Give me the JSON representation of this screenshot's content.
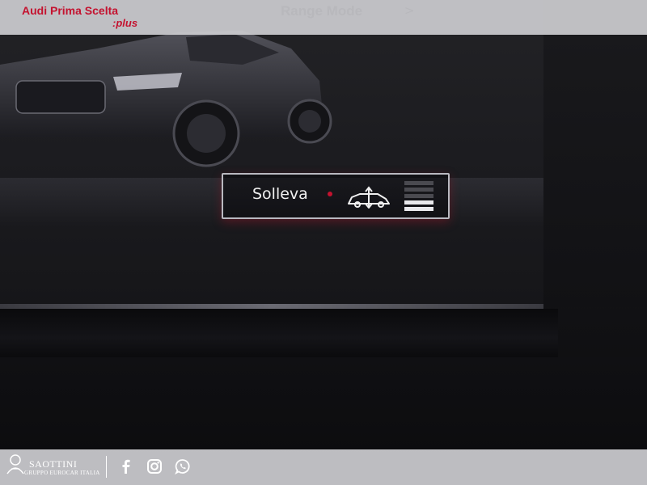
{
  "header": {
    "brand_name": "Audi Prima Scelta",
    "brand_suffix": ":plus",
    "mode_label": "Range Mode",
    "mode_arrow": ">"
  },
  "popup": {
    "label": "Solleva",
    "icon": "car-lift-icon",
    "level": 2,
    "level_count": 5
  },
  "footer": {
    "dealer_name": "SAOTTINI",
    "dealer_group": "GRUPPO EUROCAR ITALIA",
    "social": [
      "facebook-icon",
      "instagram-icon",
      "whatsapp-icon"
    ]
  },
  "colors": {
    "brand_red": "#c4122f",
    "bar_band": "#cdcdd0"
  }
}
